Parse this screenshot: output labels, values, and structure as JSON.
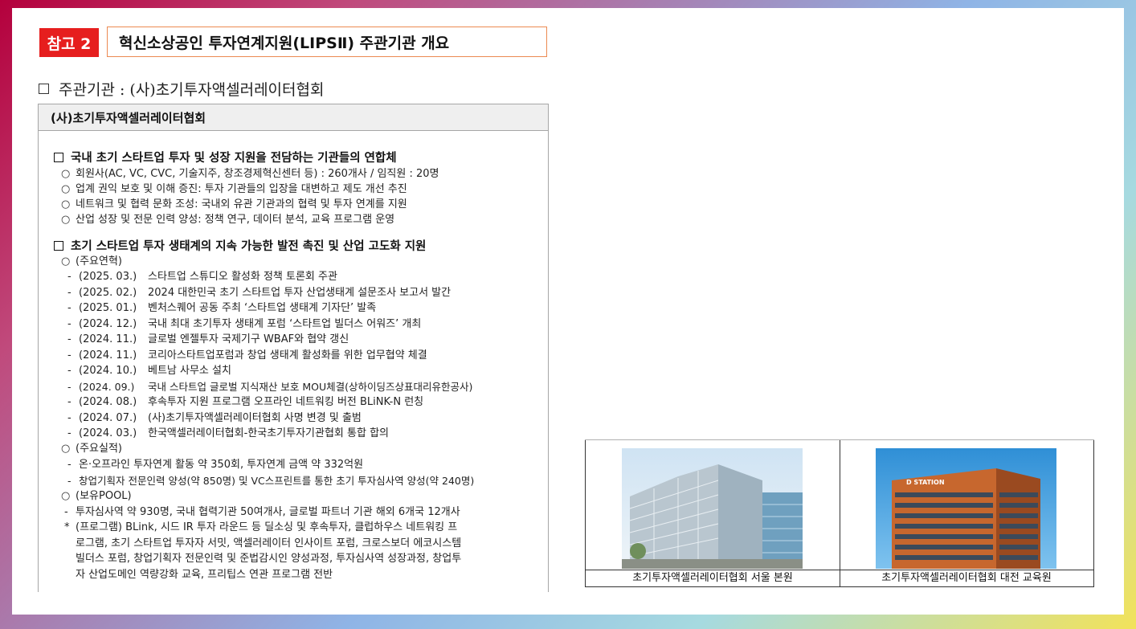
{
  "header": {
    "badge": "참고 2",
    "title": "혁신소상공인 투자연계지원(LIPSⅡ) 주관기관 개요"
  },
  "org_heading": "주관기관 : (사)초기투자액셀러레이터협회",
  "panel": {
    "title": "(사)초기투자액셀러레이터협회",
    "section1": {
      "title": "국내 초기 스타트업 투자 및 성장 지원을 전담하는 기관들의 연합체",
      "items": [
        "회원사(AC, VC, CVC, 기술지주, 창조경제혁신센터 등) : 260개사 / 임직원 : 20명",
        "업계 권익 보호 및 이해 증진: 투자 기관들의 입장을 대변하고 제도 개선 추진",
        "네트워크 및 협력 문화 조성: 국내외 유관 기관과의 협력 및 투자 연계를 지원",
        "산업 성장 및 전문 인력 양성: 정책 연구, 데이터 분석, 교육 프로그램 운영"
      ]
    },
    "section2": {
      "title": "초기 스타트업 투자 생태계의 지속 가능한 발전 촉진 및 산업 고도화 지원",
      "history_label": "(주요연혁)",
      "history": [
        {
          "date": "(2025. 03.)",
          "text": "스타트업 스튜디오 활성화 정책 토론회 주관"
        },
        {
          "date": "(2025. 02.)",
          "text": "2024 대한민국 초기 스타트업 투자 산업생태계 설문조사 보고서 발간"
        },
        {
          "date": "(2025. 01.)",
          "text": "벤처스퀘어 공동 주최 ‘스타트업 생태계 기자단’ 발족"
        },
        {
          "date": "(2024. 12.)",
          "text": "국내 최대 초기투자 생태계 포럼 ‘스타트업 빌더스 어워즈’ 개최"
        },
        {
          "date": "(2024. 11.)",
          "text": "글로벌 엔젤투자 국제기구 WBAF와 협약 갱신"
        },
        {
          "date": "(2024. 11.)",
          "text": "코리아스타트업포럼과 창업 생태계 활성화를 위한 업무협약 체결"
        },
        {
          "date": "(2024. 10.)",
          "text": "베트남 사무소 설치"
        },
        {
          "date": "(2024. 09.)",
          "text": "국내 스타트업 글로벌 지식재산 보호 MOU체결(상하이딩즈상표대리유한공사)"
        },
        {
          "date": "(2024. 08.)",
          "text": "후속투자 지원 프로그램 오프라인 네트워킹 버전 BLiNK-N 런칭"
        },
        {
          "date": "(2024. 07.)",
          "text": "(사)초기투자액셀러레이터협회 사명 변경 및 출범"
        },
        {
          "date": "(2024. 03.)",
          "text": "한국액셀러레이터협회-한국초기투자기관협회 통합 합의"
        }
      ],
      "achievements_label": "(주요실적)",
      "achievements": [
        "온·오프라인 투자연계 활동 약 350회, 투자연계 금액 약 332억원",
        "창업기획자 전문인력 양성(약 850명) 및 VC스프린트를 통한 초기 투자심사역 양성(약 240명)"
      ],
      "pool_label": "(보유POOL)",
      "pool_item": "투자심사역 약 930명, 국내 협력기관 50여개사, 글로벌 파트너 기관 해외 6개국 12개사",
      "program_lines": [
        "(프로그램) BLink, 시드 IR 투자 라운드 등 딜소싱 및 후속투자, 클럽하우스 네트워킹 프",
        "로그램, 초기 스타트업 투자자 서밋, 액셀러레이터 인사이트 포럼, 크로스보더 에코시스템",
        "빌더스 포럼, 창업기획자 전문인력 및 준법감시인 양성과정, 투자심사역 성장과정, 창업투",
        "자 산업도메인 역량강화 교육, 프리팁스 연관 프로그램 전반"
      ]
    }
  },
  "photos": {
    "seoul_caption": "초기투자액셀러레이터협회 서울 본원",
    "daejeon_caption": "초기투자액셀러레이터협회 대전 교육원",
    "sign_text": "D STATION"
  }
}
